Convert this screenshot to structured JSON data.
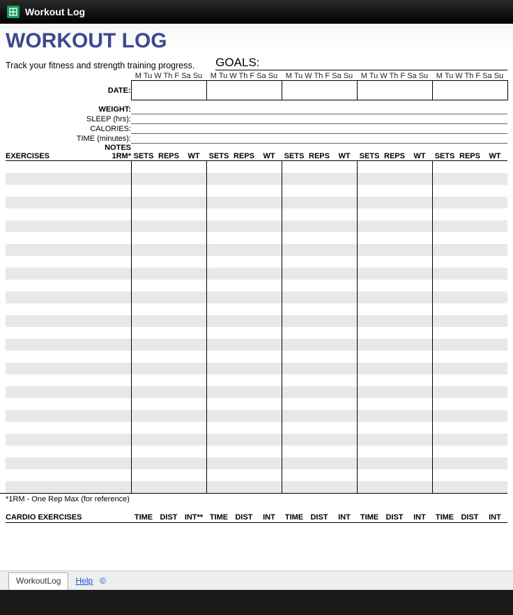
{
  "window": {
    "title": "Workout Log"
  },
  "header": {
    "title": "WORKOUT LOG",
    "subtitle": "Track your fitness and strength training progress.",
    "goals_label": "GOALS:"
  },
  "day_header": "M Tu W Th F Sa Su",
  "row_labels": {
    "date": "DATE:",
    "weight": "WEIGHT:",
    "sleep": "SLEEP (hrs):",
    "calories": "CALORIES:",
    "time": "TIME (minutes):",
    "notes": "NOTES"
  },
  "exercise_headers": {
    "exercises": "EXERCISES",
    "one_rm": "1RM*",
    "sets": "SETS",
    "reps": "REPS",
    "wt": "WT"
  },
  "footnote": "*1RM - One Rep Max (for reference)",
  "cardio_headers": {
    "label": "CARDIO EXERCISES",
    "time": "TIME",
    "dist": "DIST",
    "int": "INT",
    "int_first": "INT**"
  },
  "tabs": {
    "workout": "WorkoutLog",
    "help": "Help",
    "copy": "©"
  }
}
